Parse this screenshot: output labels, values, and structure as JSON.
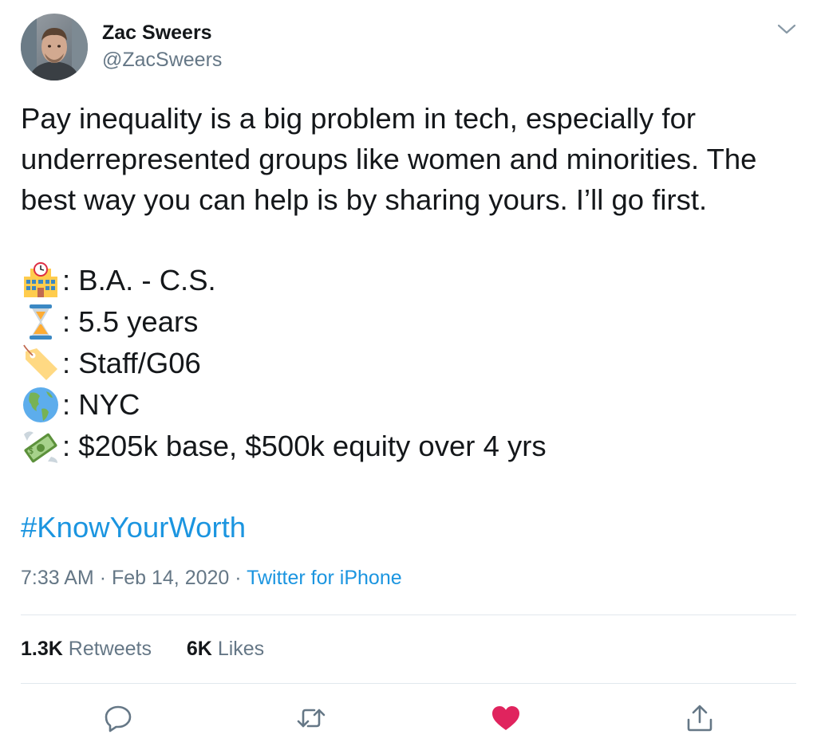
{
  "author": {
    "name": "Zac Sweers",
    "handle": "@ZacSweers"
  },
  "tweet": {
    "text_lines": [
      "Pay inequality is a big problem in tech, especially for",
      "underrepresented groups like women and minorities. The",
      "best way you can help is by sharing yours. I’ll go first."
    ],
    "facts": [
      {
        "icon": "school-building-icon",
        "text": ": B.A. - C.S."
      },
      {
        "icon": "hourglass-icon",
        "text": ": 5.5 years"
      },
      {
        "icon": "price-tag-icon",
        "text": ": Staff/G06"
      },
      {
        "icon": "globe-americas-icon",
        "text": ": NYC"
      },
      {
        "icon": "money-with-wings-icon",
        "text": ": $205k base, $500k equity over 4 yrs"
      }
    ],
    "hashtag": "#KnowYourWorth",
    "time": "7:33 AM",
    "date": "Feb 14, 2020",
    "separator": "·",
    "source": "Twitter for iPhone"
  },
  "stats": {
    "retweets_count": "1.3K",
    "retweets_label": "Retweets",
    "likes_count": "6K",
    "likes_label": "Likes"
  },
  "actions": {
    "reply_icon": "reply-icon",
    "retweet_icon": "retweet-icon",
    "like_icon": "heart-filled-icon",
    "share_icon": "share-icon",
    "liked": true
  },
  "colors": {
    "link": "#1b95e0",
    "muted": "#657786",
    "text": "#14171a",
    "like": "#e0245e",
    "divider": "#e1e8ed"
  }
}
